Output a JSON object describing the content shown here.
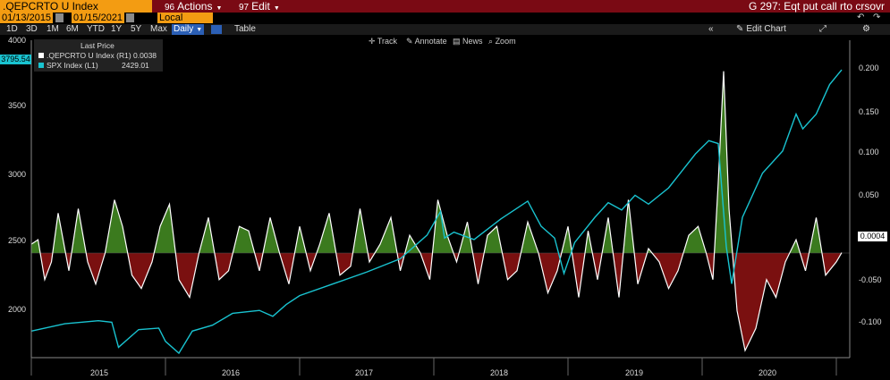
{
  "header": {
    "ticker": ".QEPCRTO U Index",
    "actions_label": "Actions",
    "actions_key": "96",
    "edit_label": "Edit",
    "edit_key": "97",
    "title": "G 297: Eqt put call rto crsovr"
  },
  "dates": {
    "start": "01/13/2015",
    "end": "01/15/2021",
    "currency": "Local CCY"
  },
  "toolbar": {
    "ranges": [
      "1D",
      "3D",
      "1M",
      "6M",
      "YTD",
      "1Y",
      "5Y",
      "Max"
    ],
    "frequency": "Daily",
    "table_label": "Table",
    "edit_chart_label": "Edit Chart"
  },
  "tools": {
    "track": "Track",
    "annotate": "Annotate",
    "news": "News",
    "zoom": "Zoom"
  },
  "legend": {
    "header": "Last Price",
    "items": [
      {
        "name": ".QEPCRTO U Index",
        "axis": "(R1)",
        "value": "0.0038",
        "color": "#ffffff"
      },
      {
        "name": "SPX Index",
        "axis": "(L1)",
        "value": "2429.01",
        "color": "#19c3d0"
      }
    ]
  },
  "tags": {
    "spx_current": "3795.54",
    "ratio_current": "0.0004"
  },
  "chart_data": {
    "type": "line",
    "x_labels": [
      "2015",
      "2016",
      "2017",
      "2018",
      "2019",
      "2020"
    ],
    "left_axis": {
      "ticks": [
        "4000",
        "3500",
        "3000",
        "2500",
        "2000"
      ],
      "range": [
        1850,
        4000
      ]
    },
    "right_axis": {
      "ticks": [
        "0.200",
        "0.150",
        "0.100",
        "0.050",
        "0.000",
        "-0.050",
        "-0.100"
      ],
      "range": [
        -0.118,
        0.24
      ]
    },
    "series": [
      {
        "name": "SPX Index",
        "axis": "left",
        "color": "#19c3d0",
        "x": [
          2015.0,
          2015.25,
          2015.5,
          2015.6,
          2015.65,
          2015.8,
          2015.95,
          2016.0,
          2016.1,
          2016.2,
          2016.35,
          2016.5,
          2016.7,
          2016.8,
          2016.9,
          2017.0,
          2017.25,
          2017.5,
          2017.75,
          2017.95,
          2018.05,
          2018.08,
          2018.15,
          2018.3,
          2018.5,
          2018.7,
          2018.8,
          2018.9,
          2018.97,
          2019.05,
          2019.2,
          2019.3,
          2019.4,
          2019.5,
          2019.6,
          2019.75,
          2019.95,
          2020.05,
          2020.12,
          2020.18,
          2020.22,
          2020.3,
          2020.45,
          2020.6,
          2020.7,
          2020.75,
          2020.85,
          2020.95,
          2021.04
        ],
        "y": [
          2030,
          2080,
          2100,
          2090,
          1920,
          2040,
          2050,
          1960,
          1880,
          2030,
          2070,
          2150,
          2170,
          2130,
          2210,
          2270,
          2350,
          2430,
          2520,
          2680,
          2840,
          2660,
          2700,
          2650,
          2790,
          2910,
          2740,
          2660,
          2420,
          2630,
          2800,
          2900,
          2850,
          2950,
          2890,
          3000,
          3230,
          3320,
          3300,
          2600,
          2350,
          2800,
          3100,
          3250,
          3500,
          3400,
          3500,
          3700,
          3800
        ]
      },
      {
        "name": ".QEPCRTO U Index",
        "axis": "right",
        "color": "#ffffff",
        "x": [
          2015.0,
          2015.05,
          2015.1,
          2015.15,
          2015.2,
          2015.28,
          2015.35,
          2015.42,
          2015.48,
          2015.55,
          2015.62,
          2015.68,
          2015.75,
          2015.82,
          2015.9,
          2015.96,
          2016.03,
          2016.1,
          2016.18,
          2016.25,
          2016.32,
          2016.4,
          2016.47,
          2016.55,
          2016.62,
          2016.7,
          2016.78,
          2016.85,
          2016.92,
          2017.0,
          2017.08,
          2017.15,
          2017.22,
          2017.3,
          2017.38,
          2017.45,
          2017.52,
          2017.6,
          2017.68,
          2017.75,
          2017.82,
          2017.9,
          2017.97,
          2018.03,
          2018.1,
          2018.17,
          2018.25,
          2018.33,
          2018.4,
          2018.47,
          2018.55,
          2018.62,
          2018.7,
          2018.78,
          2018.85,
          2018.92,
          2019.0,
          2019.08,
          2019.15,
          2019.22,
          2019.3,
          2019.38,
          2019.45,
          2019.52,
          2019.6,
          2019.68,
          2019.75,
          2019.82,
          2019.9,
          2019.97,
          2020.03,
          2020.08,
          2020.12,
          2020.16,
          2020.2,
          2020.26,
          2020.32,
          2020.4,
          2020.48,
          2020.55,
          2020.62,
          2020.7,
          2020.77,
          2020.85,
          2020.92,
          2021.0,
          2021.04
        ],
        "y": [
          0.01,
          0.015,
          -0.03,
          -0.01,
          0.045,
          -0.02,
          0.05,
          -0.01,
          -0.035,
          0.0,
          0.06,
          0.03,
          -0.025,
          -0.04,
          -0.01,
          0.03,
          0.055,
          -0.03,
          -0.05,
          0.0,
          0.04,
          -0.03,
          -0.02,
          0.03,
          0.025,
          -0.02,
          0.04,
          0.0,
          -0.035,
          0.03,
          -0.02,
          0.01,
          0.045,
          -0.025,
          -0.015,
          0.05,
          -0.01,
          0.01,
          0.04,
          -0.02,
          0.02,
          0.0,
          -0.03,
          0.06,
          0.02,
          -0.01,
          0.035,
          -0.035,
          0.02,
          0.03,
          -0.03,
          -0.02,
          0.035,
          0.0,
          -0.045,
          -0.02,
          0.03,
          -0.05,
          0.025,
          -0.03,
          0.04,
          -0.05,
          0.06,
          -0.035,
          0.005,
          -0.01,
          -0.04,
          -0.02,
          0.02,
          0.03,
          0.0,
          -0.03,
          0.08,
          0.205,
          0.05,
          -0.065,
          -0.11,
          -0.085,
          -0.03,
          -0.05,
          -0.01,
          0.015,
          -0.02,
          0.04,
          -0.025,
          -0.01,
          0.0004
        ]
      }
    ]
  }
}
